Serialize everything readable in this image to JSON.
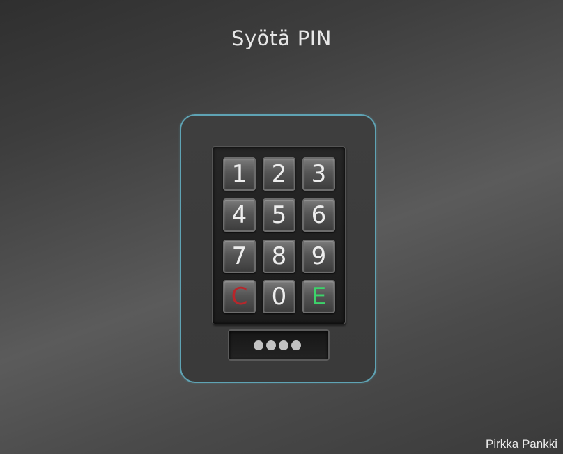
{
  "screen": {
    "title": "Syötä PIN",
    "footer_label": "Pirkka Pankki"
  },
  "keypad": {
    "keys": [
      {
        "label": "1",
        "role": "digit"
      },
      {
        "label": "2",
        "role": "digit"
      },
      {
        "label": "3",
        "role": "digit"
      },
      {
        "label": "4",
        "role": "digit"
      },
      {
        "label": "5",
        "role": "digit"
      },
      {
        "label": "6",
        "role": "digit"
      },
      {
        "label": "7",
        "role": "digit"
      },
      {
        "label": "8",
        "role": "digit"
      },
      {
        "label": "9",
        "role": "digit"
      },
      {
        "label": "C",
        "role": "clear"
      },
      {
        "label": "0",
        "role": "digit"
      },
      {
        "label": "E",
        "role": "enter"
      }
    ],
    "clear_color": "#b8262b",
    "enter_color": "#3dd36a"
  },
  "pin_display": {
    "entered_count": 4,
    "mask": "••••"
  },
  "colors": {
    "panel_border": "#5fa3b4"
  }
}
